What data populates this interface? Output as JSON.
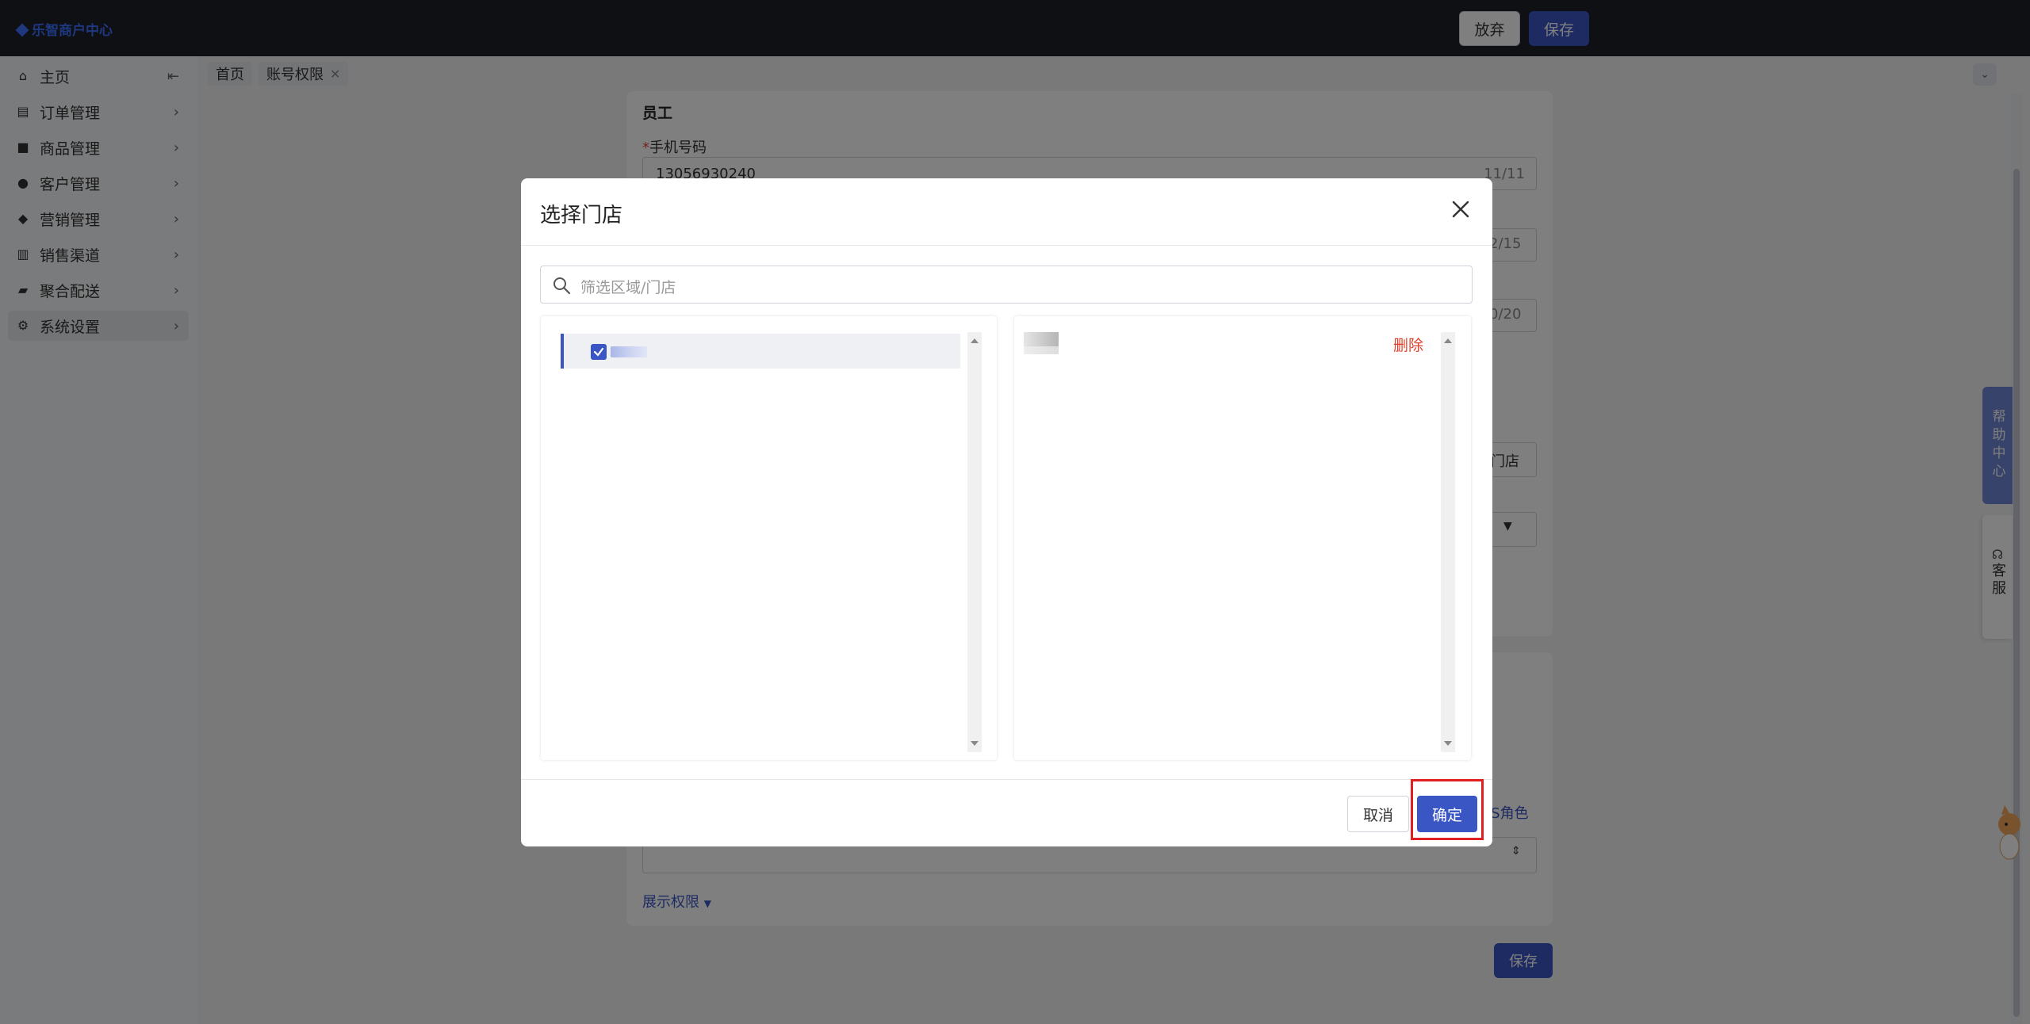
{
  "header": {
    "brand": "乐智商户中心",
    "discard_label": "放弃",
    "save_label": "保存"
  },
  "sidebar": {
    "items": [
      {
        "label": "主页",
        "icon": "home-icon"
      },
      {
        "label": "订单管理",
        "icon": "order-icon"
      },
      {
        "label": "商品管理",
        "icon": "goods-icon"
      },
      {
        "label": "客户管理",
        "icon": "user-icon"
      },
      {
        "label": "营销管理",
        "icon": "tag-icon"
      },
      {
        "label": "销售渠道",
        "icon": "bank-icon"
      },
      {
        "label": "聚合配送",
        "icon": "truck-icon"
      },
      {
        "label": "系统设置",
        "icon": "gear-icon"
      }
    ],
    "active_index": 7
  },
  "tabs": [
    {
      "label": "首页"
    },
    {
      "label": "账号权限",
      "closable": true
    }
  ],
  "form": {
    "section_title": "员工",
    "phone_label": "手机号码",
    "phone_value": "13056930240",
    "phone_count": "11/11",
    "name_count": "2/15",
    "field3_count": "0/20",
    "store_button_fragment": "门店",
    "pos_role_fragment": "OS角色",
    "show_permissions": "展示权限",
    "save_label": "保存"
  },
  "widgets": {
    "help_center": "帮助中心",
    "customer_service": "客服"
  },
  "modal": {
    "title": "选择门店",
    "search_placeholder": "筛选区域/门店",
    "delete_label": "删除",
    "cancel_label": "取消",
    "ok_label": "确定"
  },
  "colors": {
    "accent": "#3a56c4",
    "danger": "#e0402b",
    "topbar": "#1f2126"
  }
}
